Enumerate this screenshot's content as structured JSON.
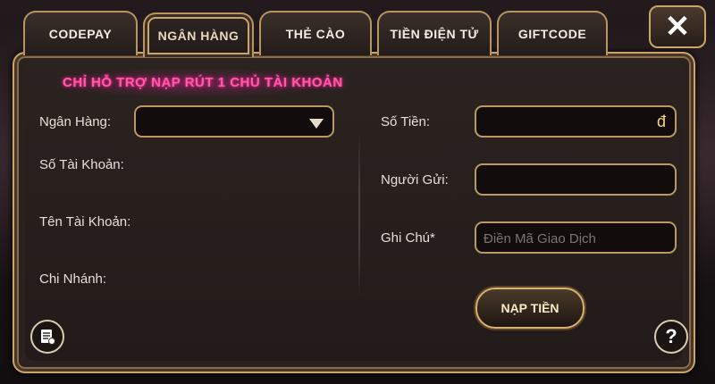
{
  "tabs": [
    {
      "label": "CODEPAY",
      "active": false
    },
    {
      "label": "NGÂN HÀNG",
      "active": true
    },
    {
      "label": "THẺ CÀO",
      "active": false
    },
    {
      "label": "TIỀN ĐIỆN TỬ",
      "active": false
    },
    {
      "label": "GIFTCODE",
      "active": false
    }
  ],
  "close_label": "✕",
  "notice": "CHỈ HỖ TRỢ NẠP RÚT 1 CHỦ TÀI KHOẢN",
  "left_form": {
    "bank_label": "Ngân Hàng:",
    "bank_value": "",
    "account_number_label": "Số Tài Khoản:",
    "account_name_label": "Tên Tài Khoản:",
    "branch_label": "Chi Nhánh:"
  },
  "right_form": {
    "amount_label": "Số Tiền:",
    "amount_currency": "đ",
    "sender_label": "Người Gửi:",
    "note_label": "Ghi Chú*",
    "note_placeholder": "Điền Mã Giao Dịch"
  },
  "submit_label": "NẠP TIỀN",
  "help_label": "?",
  "colors": {
    "accent_gold": "#c9a56a",
    "notice_pink": "#ff5aa6",
    "panel": "#2a2220"
  }
}
